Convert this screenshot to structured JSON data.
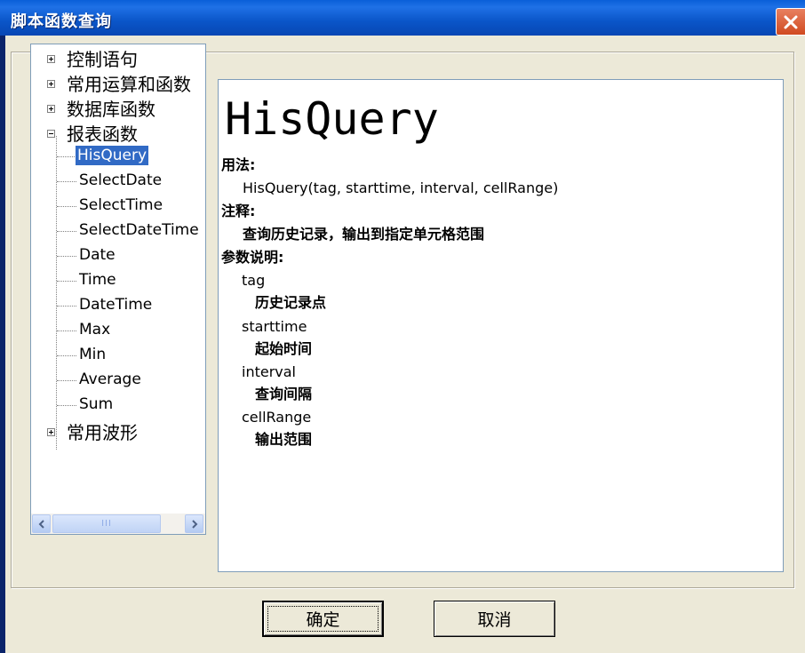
{
  "window": {
    "title": "脚本函数查询",
    "close_label": "close"
  },
  "tree": {
    "top_items": [
      {
        "label": "控制语句",
        "state": "collapsed"
      },
      {
        "label": "常用运算和函数",
        "state": "collapsed"
      },
      {
        "label": "数据库函数",
        "state": "collapsed"
      },
      {
        "label": "报表函数",
        "state": "expanded"
      },
      {
        "label": "常用波形",
        "state": "collapsed"
      }
    ],
    "report_children": [
      "HisQuery",
      "SelectDate",
      "SelectTime",
      "SelectDateTime",
      "Date",
      "Time",
      "DateTime",
      "Max",
      "Min",
      "Average",
      "Sum"
    ],
    "selected": "HisQuery",
    "scrollbar_grip": "III"
  },
  "content": {
    "title": "HisQuery",
    "usage_heading": "用法:",
    "usage": "HisQuery(tag, starttime, interval, cellRange)",
    "note_heading": "注释:",
    "note": "查询历史记录，输出到指定单元格范围",
    "params_heading": "参数说明:",
    "params": [
      {
        "name": "tag",
        "desc": "历史记录点"
      },
      {
        "name": "starttime",
        "desc": "起始时间"
      },
      {
        "name": "interval",
        "desc": "查询间隔"
      },
      {
        "name": "cellRange",
        "desc": "输出范围"
      }
    ]
  },
  "buttons": {
    "ok": "确定",
    "cancel": "取消"
  },
  "colors": {
    "title_bar": "#0a55c8",
    "selection": "#316ac5",
    "dialog_bg": "#ece9d8",
    "close_button": "#d04a20"
  }
}
